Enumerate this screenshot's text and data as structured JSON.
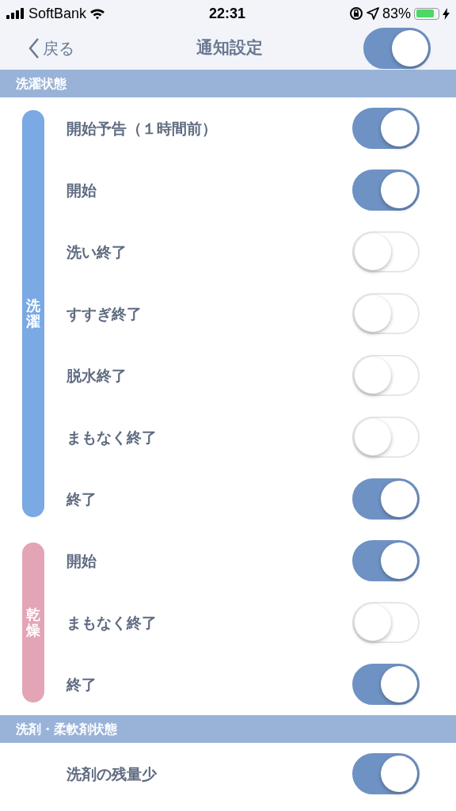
{
  "status_bar": {
    "carrier": "SoftBank",
    "time": "22:31",
    "battery": "83%"
  },
  "header": {
    "back": "戻る",
    "title": "通知設定",
    "master_on": true
  },
  "sections": [
    {
      "title": "洗濯状態",
      "groups": [
        {
          "label": "洗濯",
          "color": "#7aa9e3",
          "items": [
            {
              "label": "開始予告（１時間前）",
              "on": true
            },
            {
              "label": "開始",
              "on": true
            },
            {
              "label": "洗い終了",
              "on": false
            },
            {
              "label": "すすぎ終了",
              "on": false
            },
            {
              "label": "脱水終了",
              "on": false
            },
            {
              "label": "まもなく終了",
              "on": false
            },
            {
              "label": "終了",
              "on": true
            }
          ]
        },
        {
          "label": "乾燥",
          "color": "#e3a5b5",
          "items": [
            {
              "label": "開始",
              "on": true
            },
            {
              "label": "まもなく終了",
              "on": false
            },
            {
              "label": "終了",
              "on": true
            }
          ]
        }
      ]
    },
    {
      "title": "洗剤・柔軟剤状態",
      "groups": [
        {
          "items": [
            {
              "label": "洗剤の残量少",
              "on": true
            }
          ]
        }
      ]
    }
  ]
}
